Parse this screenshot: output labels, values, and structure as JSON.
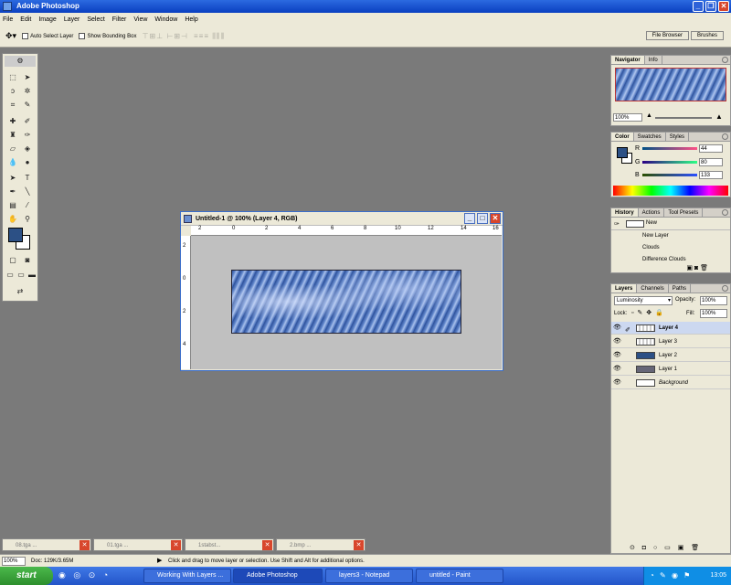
{
  "window": {
    "title": "Adobe Photoshop"
  },
  "menu": [
    "File",
    "Edit",
    "Image",
    "Layer",
    "Select",
    "Filter",
    "View",
    "Window",
    "Help"
  ],
  "options_bar": {
    "auto_select_label": "Auto Select Layer",
    "bounding_box_label": "Show Bounding Box",
    "file_browser_tab": "File Browser",
    "brushes_tab": "Brushes"
  },
  "document": {
    "title": "Untitled-1 @ 100% (Layer 4, RGB)",
    "ruler_top": [
      "2",
      "0",
      "2",
      "4",
      "6",
      "8",
      "10",
      "12",
      "14",
      "16"
    ],
    "ruler_left": [
      "2",
      "0",
      "2",
      "4"
    ]
  },
  "navigator": {
    "tabs": [
      "Navigator",
      "Info"
    ],
    "zoom": "100%"
  },
  "color": {
    "tabs": [
      "Color",
      "Swatches",
      "Styles"
    ],
    "r_label": "R",
    "g_label": "G",
    "b_label": "B",
    "r": "44",
    "g": "80",
    "b": "133",
    "foreground": "#2c5085"
  },
  "history": {
    "tabs": [
      "History",
      "Actions",
      "Tool Presets"
    ],
    "items": [
      "New",
      "New Layer",
      "Clouds",
      "Difference Clouds"
    ]
  },
  "layers": {
    "tabs": [
      "Layers",
      "Channels",
      "Paths"
    ],
    "blend_mode": "Luminosity",
    "opacity_label": "Opacity:",
    "opacity": "100%",
    "lock_label": "Lock:",
    "fill_label": "Fill:",
    "fill": "100%",
    "items": [
      "Layer 4",
      "Layer 3",
      "Layer 2",
      "Layer 1",
      "Background"
    ]
  },
  "minimized": [
    "08.tga ...",
    "01.tga ...",
    "1stabst...",
    "2.bmp ..."
  ],
  "status": {
    "zoom": "100%",
    "doc": "Doc: 129K/3.65M",
    "hint": "Click and drag to move layer or selection. Use Shift and Alt for additional options."
  },
  "taskbar": {
    "start": "start",
    "tasks": [
      "Working With Layers ...",
      "Adobe Photoshop",
      "layers3 - Notepad",
      "untitled - Paint"
    ],
    "clock": "13:05"
  }
}
